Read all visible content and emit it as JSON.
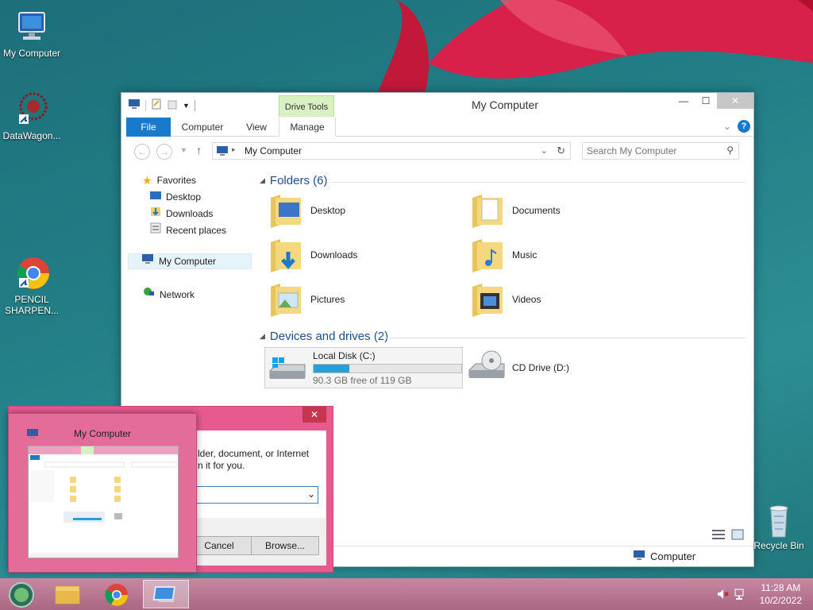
{
  "desktop": {
    "icons": [
      {
        "label": "My Computer"
      },
      {
        "label": "DataWagon..."
      },
      {
        "label": "PENCIL SHARPEN..."
      }
    ],
    "recycle_bin": "Recycle Bin"
  },
  "explorer": {
    "title": "My Computer",
    "contextual_tab": "Drive Tools",
    "tabs": [
      "File",
      "Computer",
      "View",
      "Manage"
    ],
    "address": "My Computer",
    "search_placeholder": "Search My Computer",
    "nav": {
      "favorites": "Favorites",
      "desktop": "Desktop",
      "downloads": "Downloads",
      "recent": "Recent places",
      "computer": "My Computer",
      "network": "Network"
    },
    "folders_header": "Folders (6)",
    "folders": [
      "Desktop",
      "Documents",
      "Downloads",
      "Music",
      "Pictures",
      "Videos"
    ],
    "devices_header": "Devices and drives (2)",
    "drives": [
      {
        "name": "Local Disk (C:)",
        "free": "90.3 GB free of 119 GB",
        "used_fraction": 0.24
      },
      {
        "name": "CD Drive (D:)"
      }
    ],
    "status_location": "Computer"
  },
  "run_dialog": {
    "text_line1": "lder, document, or Internet",
    "text_line2": "n it for you.",
    "cancel": "Cancel",
    "browse": "Browse...",
    "close": "✕"
  },
  "thumbnail": {
    "title": "My Computer"
  },
  "taskbar": {
    "time": "11:28 AM",
    "date": "10/2/2022"
  },
  "colors": {
    "accent": "#1979ca",
    "drive_tools": "#d8f0c2",
    "progress": "#26a0da",
    "dialog_frame": "#e75a8d"
  }
}
